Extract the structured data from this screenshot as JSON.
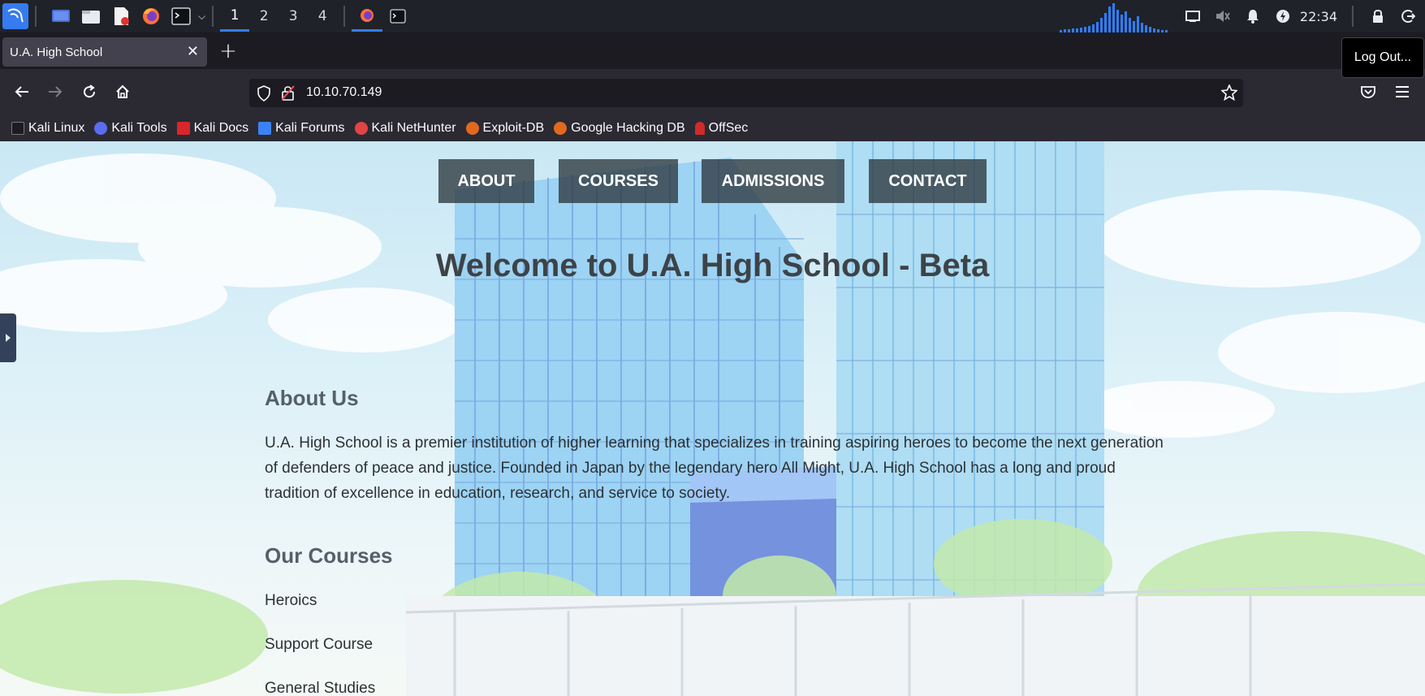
{
  "taskbar": {
    "workspaces": [
      "1",
      "2",
      "3",
      "4"
    ],
    "clock": "22:34",
    "icons": [
      "kali-menu-icon",
      "desktop-icon",
      "file-manager-icon",
      "text-editor-icon",
      "firefox-icon",
      "terminal-icon",
      "dropdown-icon"
    ],
    "accent": "#367bf0"
  },
  "browser": {
    "tab_title": "U.A. High School",
    "url": "10.10.70.149",
    "tooltip": "Log Out...",
    "bookmarks": [
      "Kali Linux",
      "Kali Tools",
      "Kali Docs",
      "Kali Forums",
      "Kali NetHunter",
      "Exploit-DB",
      "Google Hacking DB",
      "OffSec"
    ]
  },
  "page": {
    "nav": [
      "ABOUT",
      "COURSES",
      "ADMISSIONS",
      "CONTACT"
    ],
    "title": "Welcome to U.A. High School - Beta",
    "about_heading": "About Us",
    "about_text": "U.A. High School is a premier institution of higher learning that specializes in training aspiring heroes to become the next generation of defenders of peace and justice. Founded in Japan by the legendary hero All Might, U.A. High School has a long and proud tradition of excellence in education, research, and service to society.",
    "courses_heading": "Our Courses",
    "courses": [
      "Heroics",
      "Support Course",
      "General Studies"
    ]
  }
}
